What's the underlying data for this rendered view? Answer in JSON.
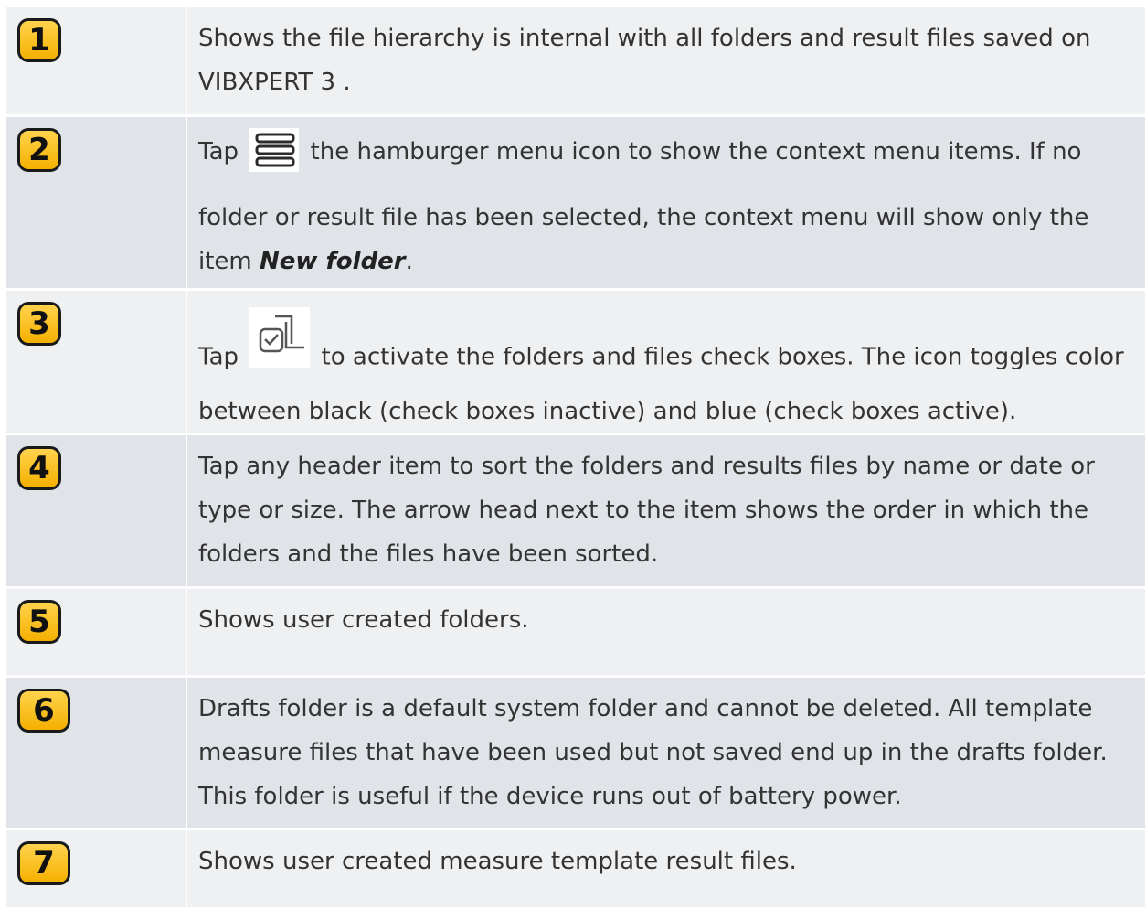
{
  "rows": [
    {
      "number": "1",
      "lines": [
        "Shows the file hierarchy is internal with all folders and result files saved on",
        "VIBXPERT 3 ."
      ]
    },
    {
      "number": "2",
      "line1_before": "Tap",
      "icon": "hamburger-menu-icon",
      "line1_after": "the hamburger menu icon to show the context menu items. If no",
      "line2": "folder or result file has been selected, the context menu will show only the",
      "line3_before": "item",
      "line3_bold": "New folder",
      "line3_after": "."
    },
    {
      "number": "3",
      "line1_before": "Tap",
      "icon": "multi-select-checkbox-icon",
      "line1_after": "to activate the folders and files check boxes. The icon toggles color",
      "line2": "between black (check boxes inactive) and blue (check boxes active)."
    },
    {
      "number": "4",
      "lines": [
        "Tap any header item to sort the folders and results files by name or date or",
        "type or size. The arrow head next to the item shows the order in which the",
        "folders and the files have been sorted."
      ]
    },
    {
      "number": "5",
      "lines": [
        "Shows user created folders."
      ]
    },
    {
      "number": "6",
      "lines": [
        "Drafts folder is a default system folder and cannot be deleted. All template",
        "measure files that have been used but not saved end up in the drafts folder.",
        "This folder is useful if the device runs out of battery power."
      ]
    },
    {
      "number": "7",
      "lines": [
        "Shows user created measure template result files."
      ]
    }
  ],
  "colors": {
    "badge": "#f5b000",
    "row_light": "#eef0f2",
    "row_dark": "#e0e3e7",
    "text": "#333333"
  }
}
